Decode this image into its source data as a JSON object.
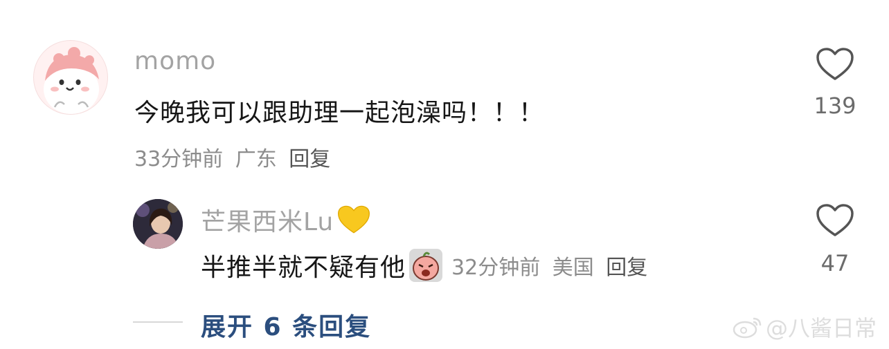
{
  "comments": [
    {
      "username": "momo",
      "text": "今晚我可以跟助理一起泡澡吗！！！",
      "time": "33分钟前",
      "location": "广东",
      "reply_label": "回复",
      "like_count": "139",
      "avatar_icon": "cartoon-face-avatar"
    }
  ],
  "replies": [
    {
      "username": "芒果西米Lu",
      "username_emoji": "yellow-heart-icon",
      "text": "半推半就不疑有他",
      "text_emoji": "crying-face-sticker-icon",
      "time": "32分钟前",
      "location": "美国",
      "reply_label": "回复",
      "like_count": "47",
      "avatar_icon": "photo-avatar"
    }
  ],
  "expand_label": "展开 6 条回复",
  "watermark": "@八酱日常",
  "colors": {
    "link_blue": "#2b4e7e",
    "name_gray": "#a3a3a3",
    "heart_yellow": "#f8c81f"
  }
}
